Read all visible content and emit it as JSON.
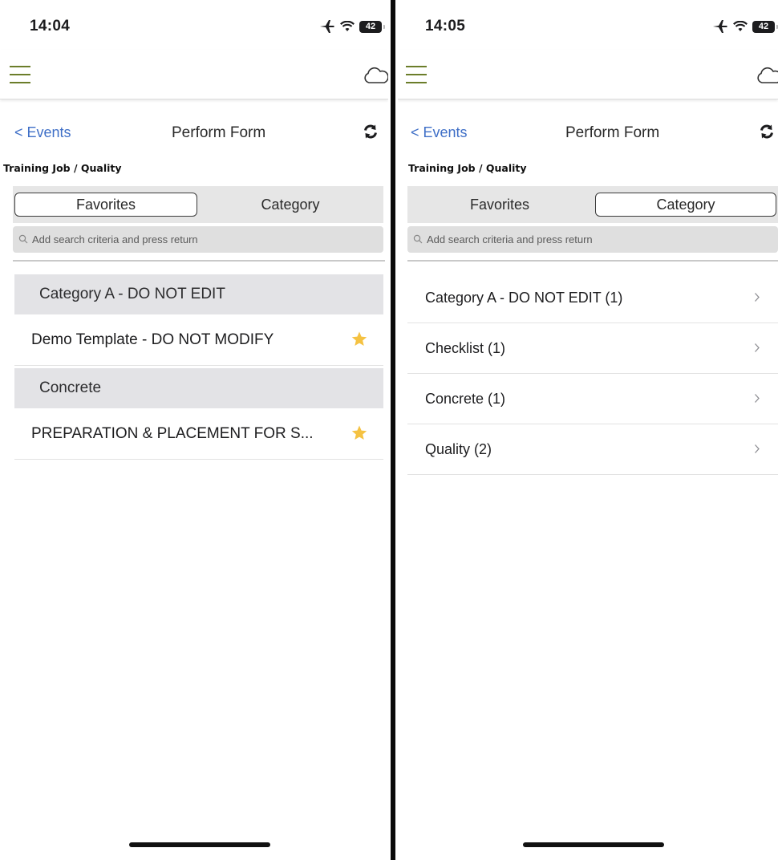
{
  "left": {
    "status": {
      "time": "14:04",
      "battery": "42"
    },
    "header": {
      "back_label": "< Events",
      "title": "Perform Form"
    },
    "breadcrumb": "Training Job / Quality",
    "segments": {
      "favorites": "Favorites",
      "category": "Category",
      "active": "favorites"
    },
    "search": {
      "placeholder": "Add search criteria and press return"
    },
    "groups": [
      {
        "header": "Category A - DO NOT EDIT",
        "items": [
          {
            "label": "Demo Template - DO NOT MODIFY",
            "favorite": true
          }
        ]
      },
      {
        "header": "Concrete",
        "items": [
          {
            "label": "PREPARATION & PLACEMENT FOR S...",
            "favorite": true
          }
        ]
      }
    ]
  },
  "right": {
    "status": {
      "time": "14:05",
      "battery": "42"
    },
    "header": {
      "back_label": "< Events",
      "title": "Perform Form"
    },
    "breadcrumb": "Training Job / Quality",
    "segments": {
      "favorites": "Favorites",
      "category": "Category",
      "active": "category"
    },
    "search": {
      "placeholder": "Add search criteria and press return"
    },
    "categories": [
      {
        "label": "Category A - DO NOT EDIT (1)"
      },
      {
        "label": "Checklist (1)"
      },
      {
        "label": "Concrete (1)"
      },
      {
        "label": "Quality (2)"
      }
    ]
  },
  "colors": {
    "accent_olive": "#6b7d2a",
    "link_blue": "#3f6fc7",
    "star_gold": "#f5c242",
    "group_gray": "#e3e3e6"
  },
  "icons": [
    "airplane-icon",
    "wifi-icon",
    "battery-icon",
    "hamburger-icon",
    "cloud-icon",
    "sync-icon",
    "search-icon",
    "star-icon",
    "chevron-right-icon"
  ]
}
